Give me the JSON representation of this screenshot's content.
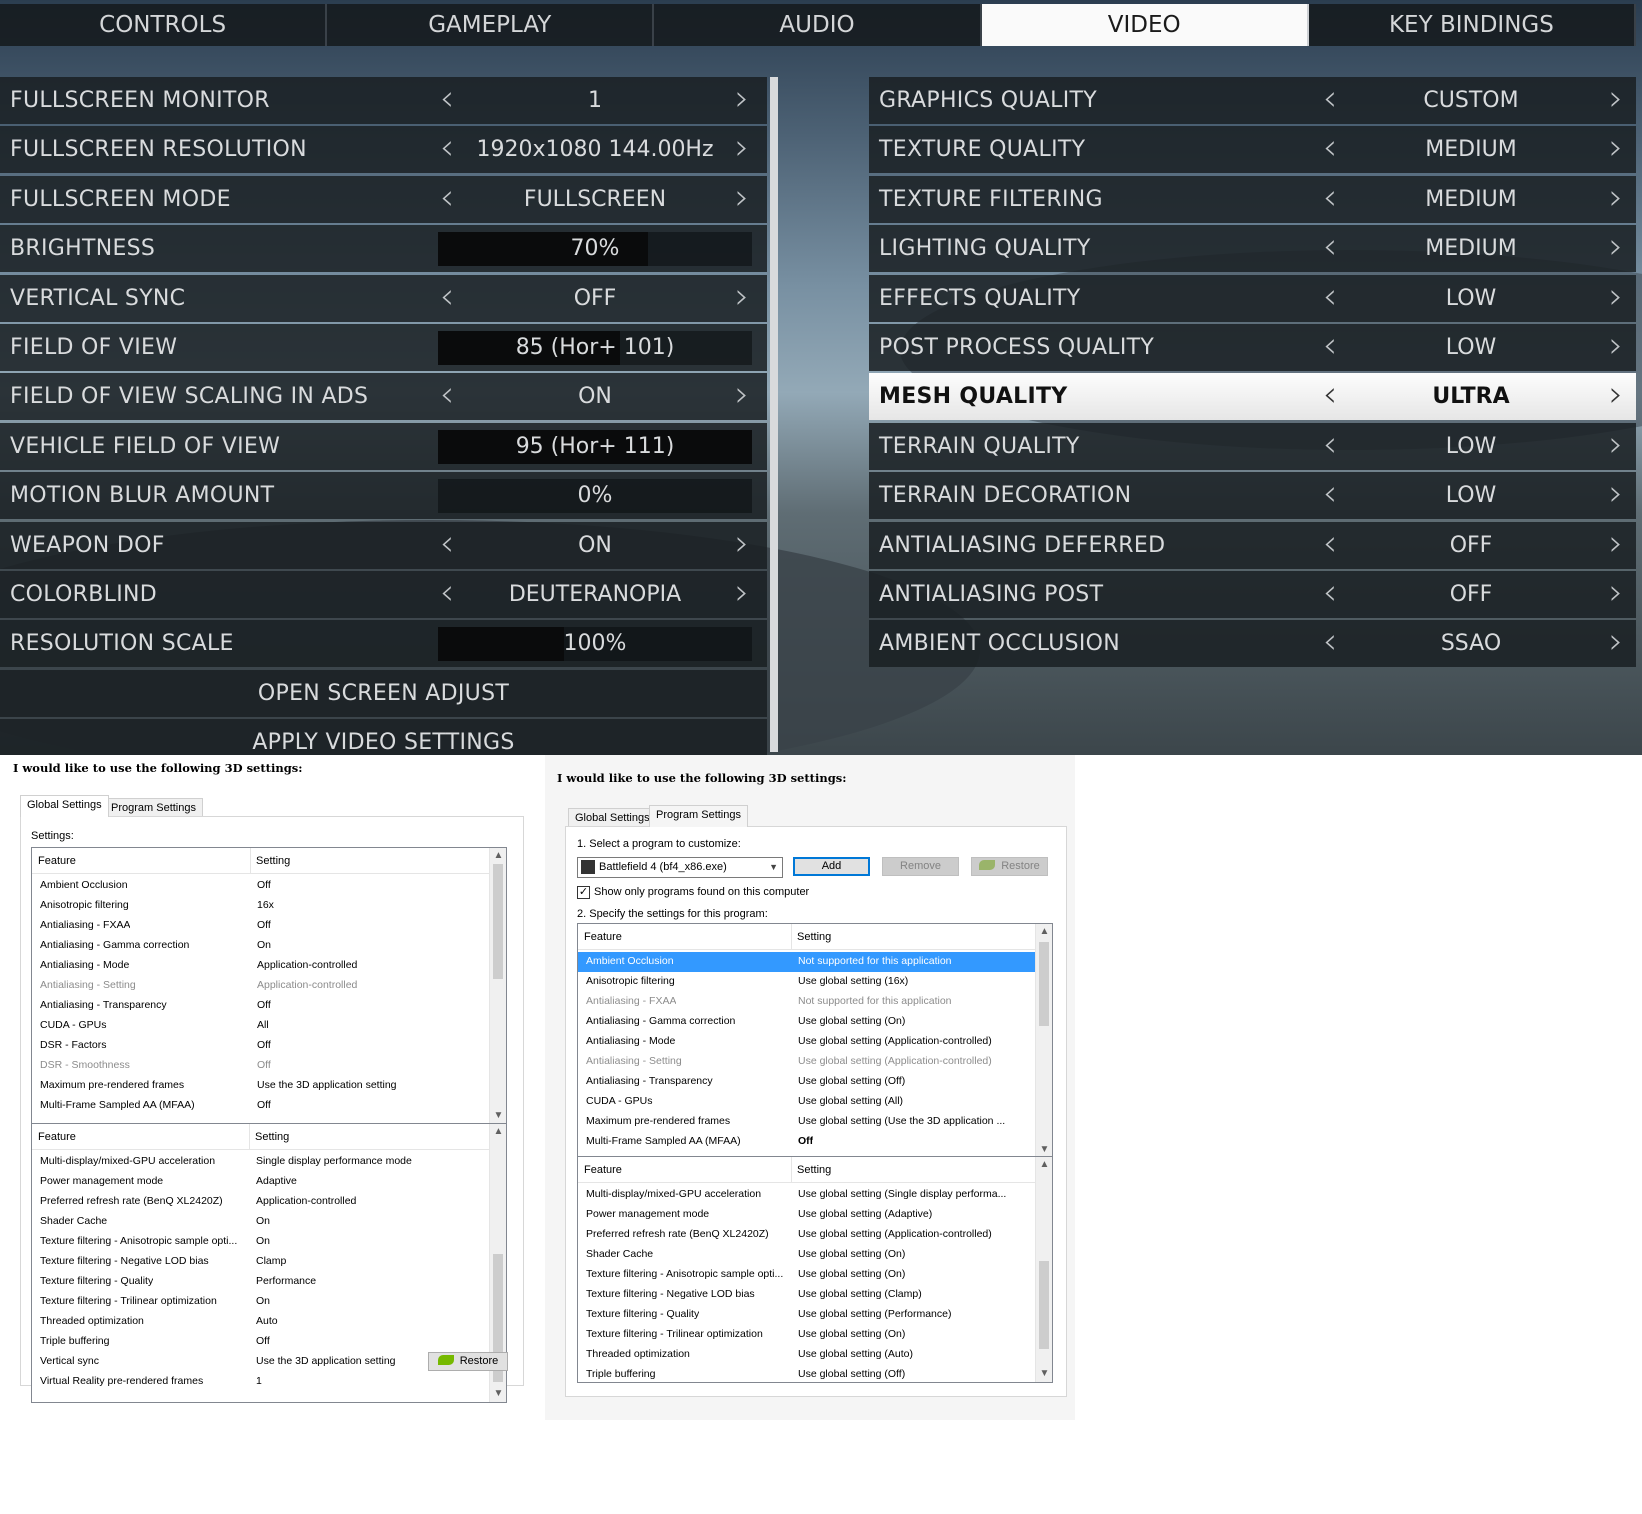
{
  "game": {
    "tabs": [
      {
        "label": "CONTROLS",
        "active": false
      },
      {
        "label": "GAMEPLAY",
        "active": false
      },
      {
        "label": "AUDIO",
        "active": false
      },
      {
        "label": "VIDEO",
        "active": true
      },
      {
        "label": "KEY BINDINGS",
        "active": false
      }
    ],
    "left_settings": [
      {
        "label": "FULLSCREEN MONITOR",
        "value": "1",
        "type": "select"
      },
      {
        "label": "FULLSCREEN RESOLUTION",
        "value": "1920x1080 144.00Hz",
        "type": "select"
      },
      {
        "label": "FULLSCREEN MODE",
        "value": "FULLSCREEN",
        "type": "select"
      },
      {
        "label": "BRIGHTNESS",
        "value": "70%",
        "type": "slider",
        "level": 0.67
      },
      {
        "label": "VERTICAL SYNC",
        "value": "OFF",
        "type": "select"
      },
      {
        "label": "FIELD OF VIEW",
        "value": "85  (Hor+ 101)",
        "type": "slider",
        "level": 0.58
      },
      {
        "label": "FIELD OF VIEW SCALING IN ADS",
        "value": "ON",
        "type": "select"
      },
      {
        "label": "VEHICLE FIELD OF VIEW",
        "value": "95  (Hor+ 111)",
        "type": "slider",
        "level": 1.0
      },
      {
        "label": "MOTION BLUR AMOUNT",
        "value": "0%",
        "type": "slider",
        "level": 0.0
      },
      {
        "label": "WEAPON DOF",
        "value": "ON",
        "type": "select"
      },
      {
        "label": "COLORBLIND",
        "value": "DEUTERANOPIA",
        "type": "select"
      },
      {
        "label": "RESOLUTION SCALE",
        "value": "100%",
        "type": "slider",
        "level": 0.4
      }
    ],
    "actions": [
      {
        "label": "OPEN SCREEN ADJUST"
      },
      {
        "label": "APPLY VIDEO SETTINGS"
      }
    ],
    "right_settings": [
      {
        "label": "GRAPHICS QUALITY",
        "value": "CUSTOM",
        "highlight": false
      },
      {
        "label": "TEXTURE QUALITY",
        "value": "MEDIUM",
        "highlight": false
      },
      {
        "label": "TEXTURE FILTERING",
        "value": "MEDIUM",
        "highlight": false
      },
      {
        "label": "LIGHTING QUALITY",
        "value": "MEDIUM",
        "highlight": false
      },
      {
        "label": "EFFECTS QUALITY",
        "value": "LOW",
        "highlight": false
      },
      {
        "label": "POST PROCESS QUALITY",
        "value": "LOW",
        "highlight": false
      },
      {
        "label": "MESH QUALITY",
        "value": "ULTRA",
        "highlight": true
      },
      {
        "label": "TERRAIN QUALITY",
        "value": "LOW",
        "highlight": false
      },
      {
        "label": "TERRAIN DECORATION",
        "value": "LOW",
        "highlight": false
      },
      {
        "label": "ANTIALIASING DEFERRED",
        "value": "OFF",
        "highlight": false
      },
      {
        "label": "ANTIALIASING POST",
        "value": "OFF",
        "highlight": false
      },
      {
        "label": "AMBIENT OCCLUSION",
        "value": "SSAO",
        "highlight": false
      }
    ]
  },
  "global_panel": {
    "heading": "I would like to use the following 3D settings:",
    "tabs": [
      "Global Settings",
      "Program Settings"
    ],
    "settings_label": "Settings:",
    "col_feature": "Feature",
    "col_setting": "Setting",
    "list1": [
      {
        "f": "Ambient Occlusion",
        "s": "Off",
        "gray": false
      },
      {
        "f": "Anisotropic filtering",
        "s": "16x",
        "gray": false
      },
      {
        "f": "Antialiasing - FXAA",
        "s": "Off",
        "gray": false
      },
      {
        "f": "Antialiasing - Gamma correction",
        "s": "On",
        "gray": false
      },
      {
        "f": "Antialiasing - Mode",
        "s": "Application-controlled",
        "gray": false
      },
      {
        "f": "Antialiasing - Setting",
        "s": "Application-controlled",
        "gray": true
      },
      {
        "f": "Antialiasing - Transparency",
        "s": "Off",
        "gray": false
      },
      {
        "f": "CUDA - GPUs",
        "s": "All",
        "gray": false
      },
      {
        "f": "DSR - Factors",
        "s": "Off",
        "gray": false
      },
      {
        "f": "DSR - Smoothness",
        "s": "Off",
        "gray": true
      },
      {
        "f": "Maximum pre-rendered frames",
        "s": "Use the 3D application setting",
        "gray": false
      },
      {
        "f": "Multi-Frame Sampled AA (MFAA)",
        "s": "Off",
        "gray": false
      }
    ],
    "list2": [
      {
        "f": "Multi-display/mixed-GPU acceleration",
        "s": "Single display performance mode"
      },
      {
        "f": "Power management mode",
        "s": "Adaptive"
      },
      {
        "f": "Preferred refresh rate (BenQ XL2420Z)",
        "s": "Application-controlled"
      },
      {
        "f": "Shader Cache",
        "s": "On"
      },
      {
        "f": "Texture filtering - Anisotropic sample opti...",
        "s": "On"
      },
      {
        "f": "Texture filtering - Negative LOD bias",
        "s": "Clamp"
      },
      {
        "f": "Texture filtering - Quality",
        "s": "Performance"
      },
      {
        "f": "Texture filtering - Trilinear optimization",
        "s": "On"
      },
      {
        "f": "Threaded optimization",
        "s": "Auto"
      },
      {
        "f": "Triple buffering",
        "s": "Off"
      },
      {
        "f": "Vertical sync",
        "s": "Use the 3D application setting"
      },
      {
        "f": "Virtual Reality pre-rendered frames",
        "s": "1"
      }
    ],
    "restore_label": "Restore"
  },
  "program_panel": {
    "heading": "I would like to use the following 3D settings:",
    "tabs": [
      "Global Settings",
      "Program Settings"
    ],
    "step1": "1. Select a program to customize:",
    "program": "Battlefield 4 (bf4_x86.exe)",
    "add_label": "Add",
    "remove_label": "Remove",
    "restore_label": "Restore",
    "show_only": "Show only programs found on this computer",
    "show_only_checked": true,
    "step2": "2. Specify the settings for this program:",
    "col_feature": "Feature",
    "col_setting": "Setting",
    "list1": [
      {
        "f": "Ambient Occlusion",
        "s": "Not supported for this application",
        "state": "sel"
      },
      {
        "f": "Anisotropic filtering",
        "s": "Use global setting (16x)",
        "state": ""
      },
      {
        "f": "Antialiasing - FXAA",
        "s": "Not supported for this application",
        "state": "gray"
      },
      {
        "f": "Antialiasing - Gamma correction",
        "s": "Use global setting (On)",
        "state": ""
      },
      {
        "f": "Antialiasing - Mode",
        "s": "Use global setting (Application-controlled)",
        "state": ""
      },
      {
        "f": "Antialiasing - Setting",
        "s": "Use global setting (Application-controlled)",
        "state": "gray"
      },
      {
        "f": "Antialiasing - Transparency",
        "s": "Use global setting (Off)",
        "state": ""
      },
      {
        "f": "CUDA - GPUs",
        "s": "Use global setting (All)",
        "state": ""
      },
      {
        "f": "Maximum pre-rendered frames",
        "s": "Use global setting (Use the 3D application ...",
        "state": ""
      },
      {
        "f": "Multi-Frame Sampled AA (MFAA)",
        "s": "Off",
        "state": "bold"
      }
    ],
    "list2": [
      {
        "f": "Multi-display/mixed-GPU acceleration",
        "s": "Use global setting (Single display performa..."
      },
      {
        "f": "Power management mode",
        "s": "Use global setting (Adaptive)"
      },
      {
        "f": "Preferred refresh rate (BenQ XL2420Z)",
        "s": "Use global setting (Application-controlled)"
      },
      {
        "f": "Shader Cache",
        "s": "Use global setting (On)"
      },
      {
        "f": "Texture filtering - Anisotropic sample opti...",
        "s": "Use global setting (On)"
      },
      {
        "f": "Texture filtering - Negative LOD bias",
        "s": "Use global setting (Clamp)"
      },
      {
        "f": "Texture filtering - Quality",
        "s": "Use global setting (Performance)"
      },
      {
        "f": "Texture filtering - Trilinear optimization",
        "s": "Use global setting (On)"
      },
      {
        "f": "Threaded optimization",
        "s": "Use global setting (Auto)"
      },
      {
        "f": "Triple buffering",
        "s": "Use global setting (Off)"
      }
    ]
  },
  "icons": {
    "prev": "chevron-left-icon",
    "next": "chevron-right-icon",
    "nvidia": "nvidia-logo-icon",
    "dropdown": "chevron-down-icon",
    "scroll_up": "scroll-up-icon",
    "scroll_down": "scroll-down-icon"
  }
}
